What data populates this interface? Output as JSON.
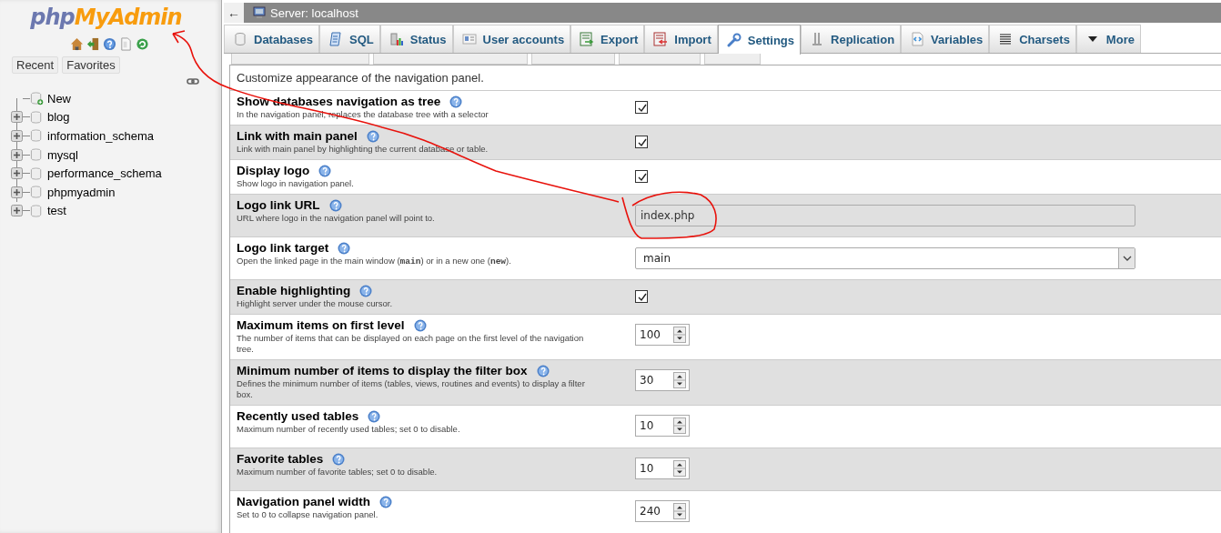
{
  "logo": {
    "part1": "php",
    "part2": "MyAdmin"
  },
  "nav_tabs": [
    {
      "label": "Recent"
    },
    {
      "label": "Favorites"
    }
  ],
  "tree": [
    {
      "label": "New",
      "kind": "new"
    },
    {
      "label": "blog",
      "kind": "db"
    },
    {
      "label": "information_schema",
      "kind": "db"
    },
    {
      "label": "mysql",
      "kind": "db"
    },
    {
      "label": "performance_schema",
      "kind": "db"
    },
    {
      "label": "phpmyadmin",
      "kind": "db"
    },
    {
      "label": "test",
      "kind": "db"
    }
  ],
  "breadcrumb": {
    "back": "←",
    "server": "Server: localhost"
  },
  "tabs": [
    {
      "label": "Databases",
      "selected": false
    },
    {
      "label": "SQL",
      "selected": false
    },
    {
      "label": "Status",
      "selected": false
    },
    {
      "label": "User accounts",
      "selected": false
    },
    {
      "label": "Export",
      "selected": false
    },
    {
      "label": "Import",
      "selected": false
    },
    {
      "label": "Settings",
      "selected": true
    },
    {
      "label": "Replication",
      "selected": false
    },
    {
      "label": "Variables",
      "selected": false
    },
    {
      "label": "Charsets",
      "selected": false
    },
    {
      "label": "More",
      "selected": false
    }
  ],
  "intro": "Customize appearance of the navigation panel.",
  "settings": [
    {
      "name": "Show databases navigation as tree",
      "description": [
        {
          "text": "In the navigation panel, replaces the database tree with a selector"
        }
      ],
      "kind": "checkbox",
      "checked": true
    },
    {
      "name": "Link with main panel",
      "description": [
        {
          "text": "Link with main panel by highlighting the current database or table."
        }
      ],
      "kind": "checkbox",
      "checked": true
    },
    {
      "name": "Display logo",
      "description": [
        {
          "text": "Show logo in navigation panel."
        }
      ],
      "kind": "checkbox",
      "checked": true
    },
    {
      "name": "Logo link URL",
      "description": [
        {
          "text": "URL where logo in the navigation panel will point to."
        }
      ],
      "kind": "text",
      "value": "index.php"
    },
    {
      "name": "Logo link target",
      "description": [
        {
          "text": "Open the linked page in the main window ("
        },
        {
          "text": "main",
          "code": true
        },
        {
          "text": ") or in a new one ("
        },
        {
          "text": "new",
          "code": true
        },
        {
          "text": ")."
        }
      ],
      "kind": "select",
      "value": "main"
    },
    {
      "name": "Enable highlighting",
      "description": [
        {
          "text": "Highlight server under the mouse cursor."
        }
      ],
      "kind": "checkbox",
      "checked": true
    },
    {
      "name": "Maximum items on first level",
      "description": [
        {
          "text": "The number of items that can be displayed on each page on the first level of the navigation tree."
        }
      ],
      "kind": "number",
      "value": "100"
    },
    {
      "name": "Minimum number of items to display the filter box",
      "description": [
        {
          "text": "Defines the minimum number of items (tables, views, routines and events) to display a filter box."
        }
      ],
      "kind": "number",
      "value": "30"
    },
    {
      "name": "Recently used tables",
      "description": [
        {
          "text": "Maximum number of recently used tables; set 0 to disable."
        }
      ],
      "kind": "number",
      "value": "10"
    },
    {
      "name": "Favorite tables",
      "description": [
        {
          "text": "Maximum number of favorite tables; set 0 to disable."
        }
      ],
      "kind": "number",
      "value": "10"
    },
    {
      "name": "Navigation panel width",
      "description": [
        {
          "text": "Set to 0 to collapse navigation panel."
        }
      ],
      "kind": "number",
      "value": "240"
    }
  ]
}
